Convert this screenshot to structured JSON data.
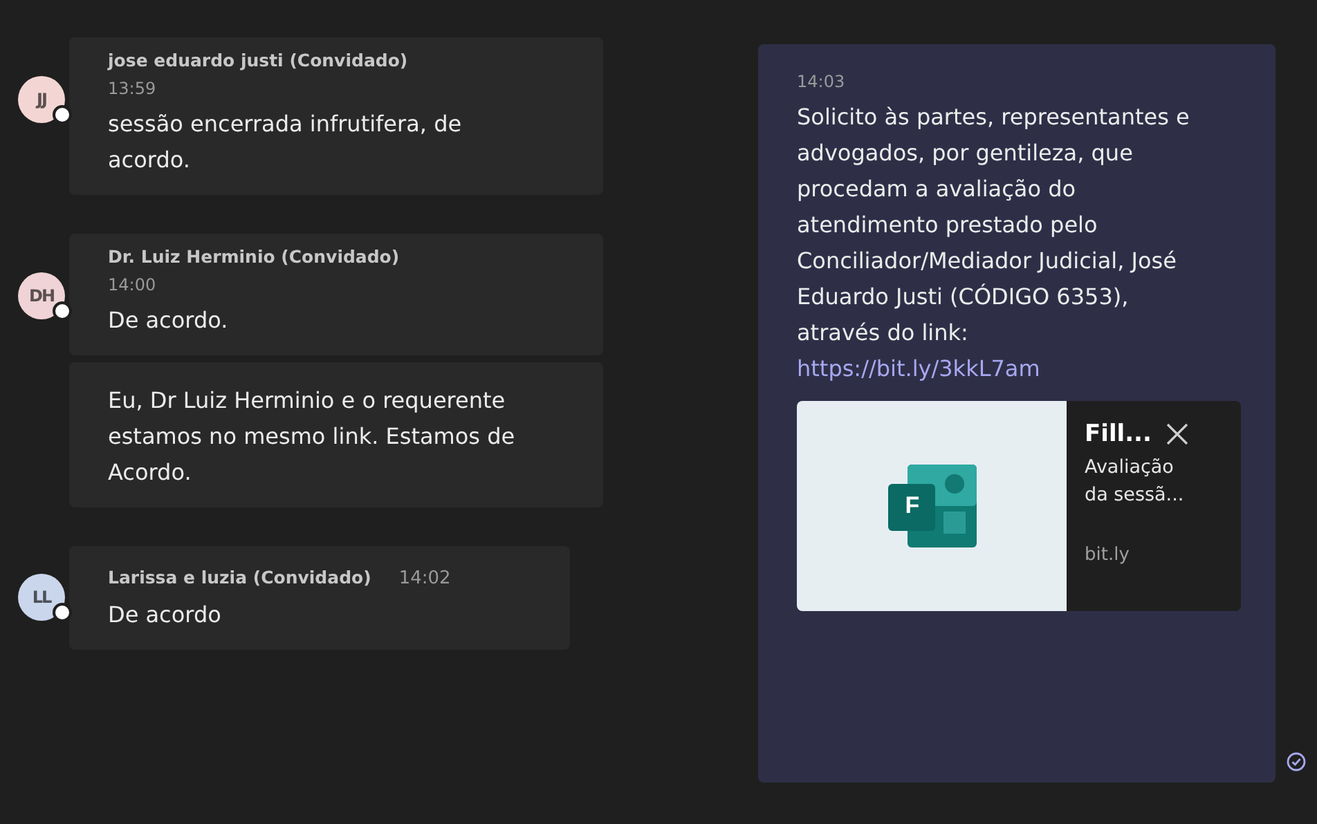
{
  "left_messages": [
    {
      "kind": "stacked",
      "initials": "JJ",
      "color": "#f3d6d3",
      "author": "jose eduardo justi (Convidado)",
      "time": "13:59",
      "bubbles": [
        "sessão encerrada infrutifera, de acordo."
      ]
    },
    {
      "kind": "stacked",
      "initials": "DH",
      "color": "#efd3d6",
      "author": "Dr. Luiz Herminio (Convidado)",
      "time": "14:00",
      "bubbles": [
        "De acordo.",
        "Eu, Dr Luiz Herminio e o requerente estamos no mesmo link. Estamos de Acordo."
      ]
    },
    {
      "kind": "inline",
      "initials": "LL",
      "color": "#c9d6ec",
      "author": "Larissa e luzia (Convidado)",
      "time": "14:02",
      "bubbles": [
        "De acordo"
      ]
    }
  ],
  "own_message": {
    "time": "14:03",
    "text": "Solicito às partes, representantes e advogados, por gentileza, que procedam a avaliação do atendimento prestado pelo Conciliador/Mediador Judicial, José Eduardo Justi (CÓDIGO 6353), através do link:",
    "link": "https://bit.ly/3kkL7am",
    "link_card": {
      "logo_letter": "F",
      "title": "Fill...",
      "description": "Avaliação da sessã...",
      "domain": "bit.ly"
    }
  }
}
